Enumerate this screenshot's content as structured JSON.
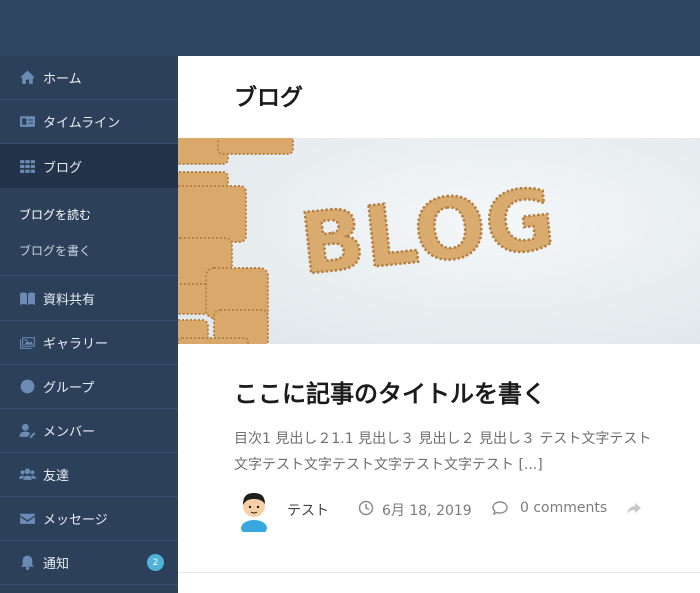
{
  "sidebar": {
    "items": [
      {
        "label": "ホーム",
        "icon": "home-icon"
      },
      {
        "label": "タイムライン",
        "icon": "id-card-icon"
      },
      {
        "label": "ブログ",
        "icon": "grid-icon"
      },
      {
        "label": "資料共有",
        "icon": "book-icon"
      },
      {
        "label": "ギャラリー",
        "icon": "image-icon"
      },
      {
        "label": "グループ",
        "icon": "group-icon"
      },
      {
        "label": "メンバー",
        "icon": "user-edit-icon"
      },
      {
        "label": "友達",
        "icon": "users-icon"
      },
      {
        "label": "メッセージ",
        "icon": "envelope-icon"
      },
      {
        "label": "通知",
        "icon": "bell-icon",
        "badge": "2"
      }
    ],
    "submenu": {
      "read": "ブログを読む",
      "write": "ブログを書く"
    }
  },
  "main": {
    "page_title": "ブログ",
    "hero_text": "BLOG",
    "article": {
      "title": "ここに記事のタイトルを書く",
      "excerpt": "目次1 見出し２1.1 見出し３ 見出し２ 見出し３ テスト文字テスト文字テスト文字テスト文字テスト文字テスト [...]",
      "author": "テスト",
      "date": "6月 18, 2019",
      "comments": "0 comments"
    }
  },
  "colors": {
    "header_bg": "#2f4661",
    "sidebar_bg": "#2c405a",
    "active_bg": "#233349",
    "icon": "#6b8bb5",
    "badge": "#4fb3d9"
  }
}
